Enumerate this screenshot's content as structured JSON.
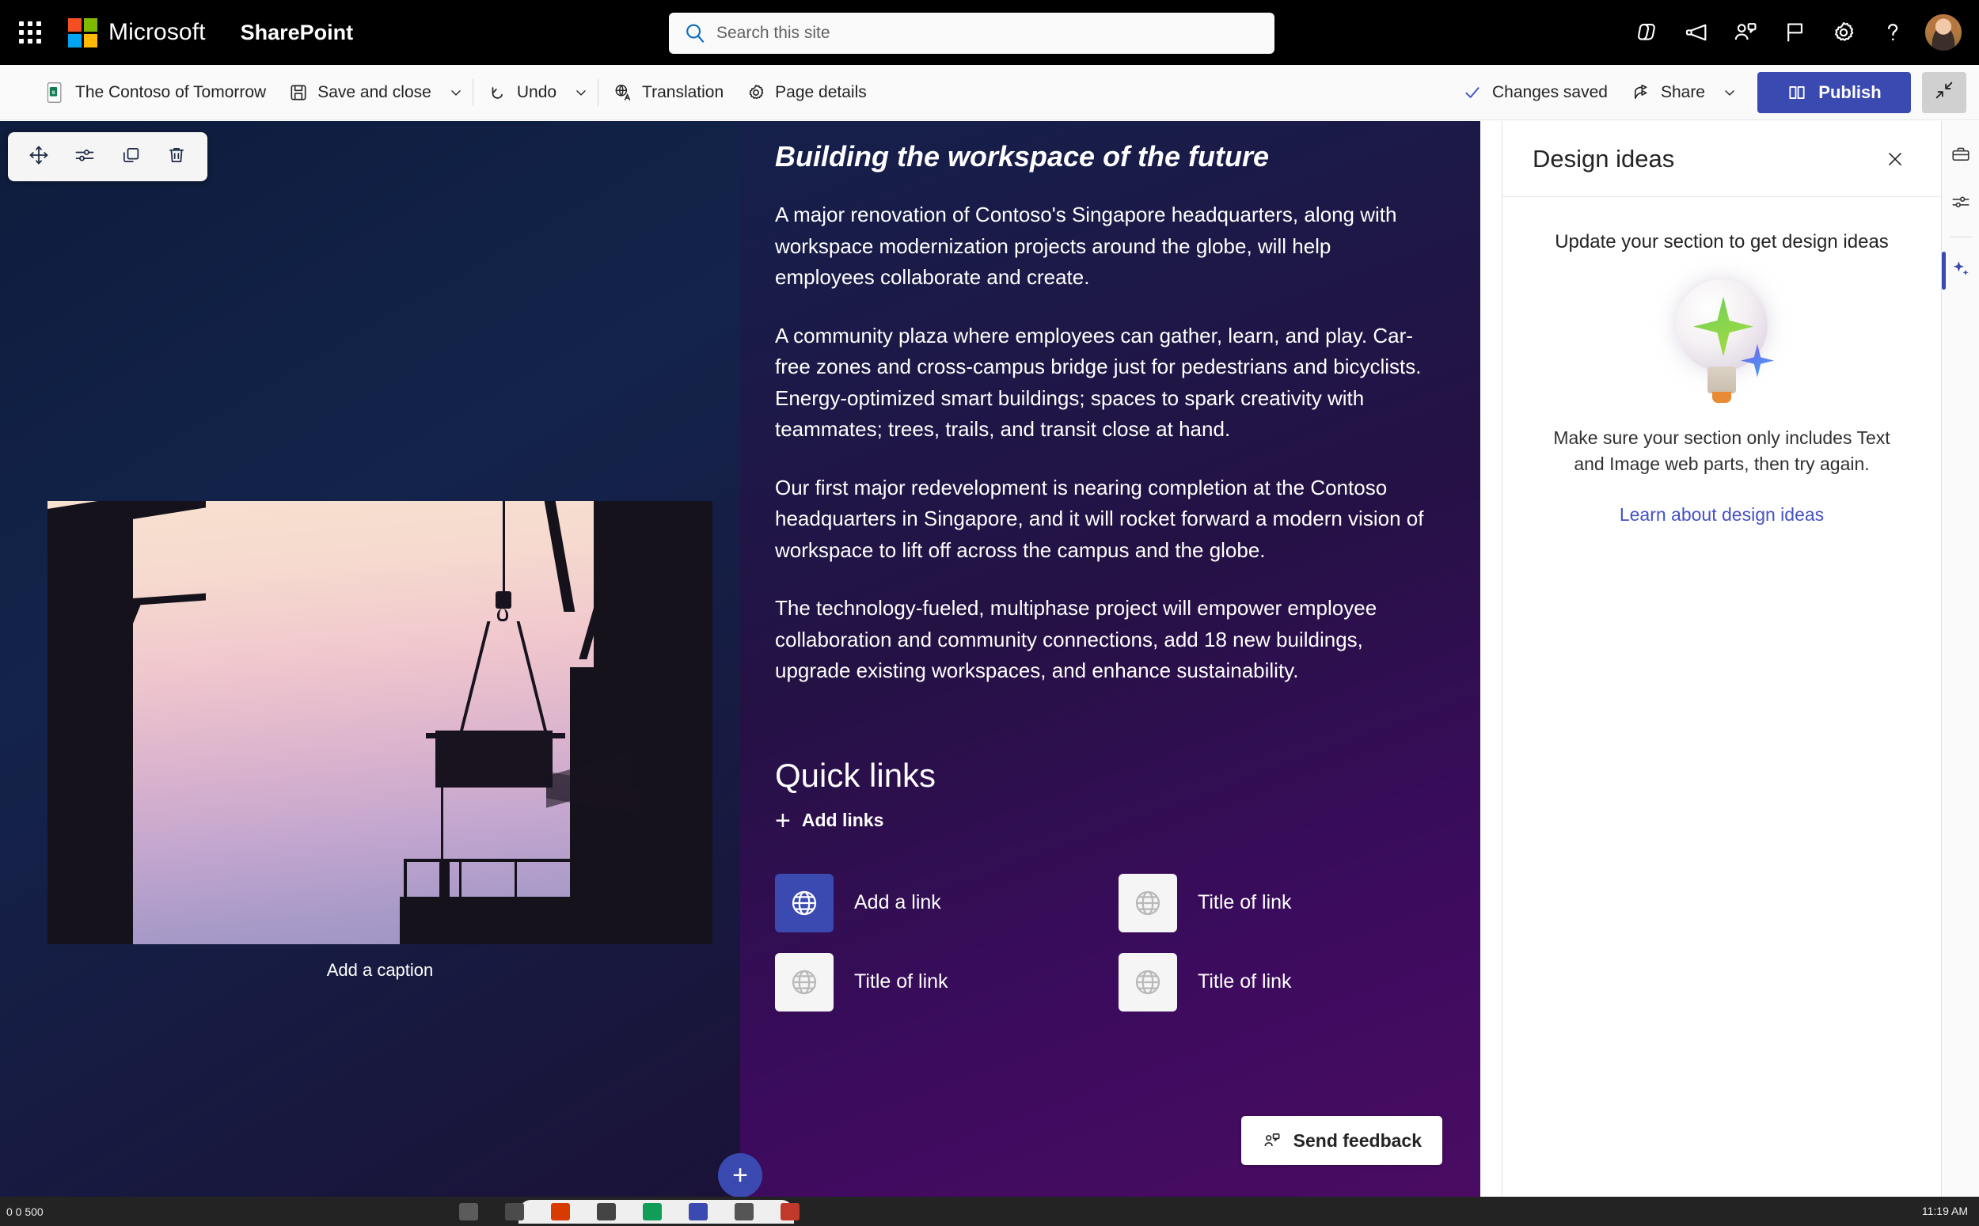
{
  "suite": {
    "app_launcher": "App launcher",
    "brand": "Microsoft",
    "product": "SharePoint",
    "icons": [
      {
        "name": "copilot-icon",
        "label": "Copilot"
      },
      {
        "name": "megaphone-icon",
        "label": "Announcements"
      },
      {
        "name": "people-share-icon",
        "label": "Share with people"
      },
      {
        "name": "flag-icon",
        "label": "Flag"
      },
      {
        "name": "gear-icon",
        "label": "Settings"
      },
      {
        "name": "help-icon",
        "label": "Help"
      }
    ],
    "avatar_label": "Account manager"
  },
  "search": {
    "placeholder": "Search this site",
    "value": ""
  },
  "command_bar": {
    "page_title": "The Contoso of Tomorrow",
    "save_and_close": "Save and close",
    "undo": "Undo",
    "translation": "Translation",
    "page_details": "Page details",
    "changes_saved": "Changes saved",
    "share": "Share",
    "publish": "Publish",
    "collapse_label": "Exit full screen"
  },
  "webpart_toolbar": {
    "move": "Move web part",
    "edit": "Edit web part",
    "duplicate": "Duplicate web part",
    "delete": "Delete web part"
  },
  "image_webpart": {
    "caption_placeholder": "Add a caption",
    "alt": "Construction site silhouette at sunset with crane and scaffolding"
  },
  "text_webpart": {
    "heading": "Building the workspace of the future",
    "paragraphs": [
      "A major renovation of Contoso's Singapore headquarters, along with workspace modernization projects around the globe, will help employees collaborate and create.",
      "A community plaza where employees can gather, learn, and play. Car-free zones and cross-campus bridge just for pedestrians and bicyclists. Energy-optimized smart buildings; spaces to spark creativity with teammates; trees, trails, and transit close at hand.",
      "Our first major redevelopment is nearing completion at the Contoso headquarters in Singapore, and it will rocket forward a modern vision of workspace to lift off across the campus and the globe.",
      "The technology-fueled, multiphase project will empower employee collaboration and community connections, add 18 new buildings, upgrade existing workspaces, and enhance sustainability."
    ]
  },
  "quick_links": {
    "title": "Quick links",
    "add_links": "Add links",
    "items": [
      {
        "label": "Add a link",
        "icon": "globe-icon",
        "selected": true
      },
      {
        "label": "Title of link",
        "icon": "globe-icon",
        "selected": false
      },
      {
        "label": "Title of link",
        "icon": "globe-icon",
        "selected": false
      },
      {
        "label": "Title of link",
        "icon": "globe-icon",
        "selected": false
      }
    ]
  },
  "feedback": {
    "label": "Send feedback"
  },
  "add_section": {
    "label": "Add a new section"
  },
  "design_panel": {
    "title": "Design ideas",
    "close_label": "Close",
    "prompt": "Update your section to get design ideas",
    "note": "Make sure your section only includes Text and Image web parts, then try again.",
    "link": "Learn about design ideas"
  },
  "rail": {
    "toolbox": "Toolbox",
    "settings": "Page settings",
    "design_ideas": "Design ideas"
  },
  "taskbar": {
    "left_text": "0 0 500",
    "clock": "11:19 AM"
  },
  "colors": {
    "accent": "#3b4ab0",
    "suite_bar": "#000000",
    "link": "#4452c7"
  }
}
